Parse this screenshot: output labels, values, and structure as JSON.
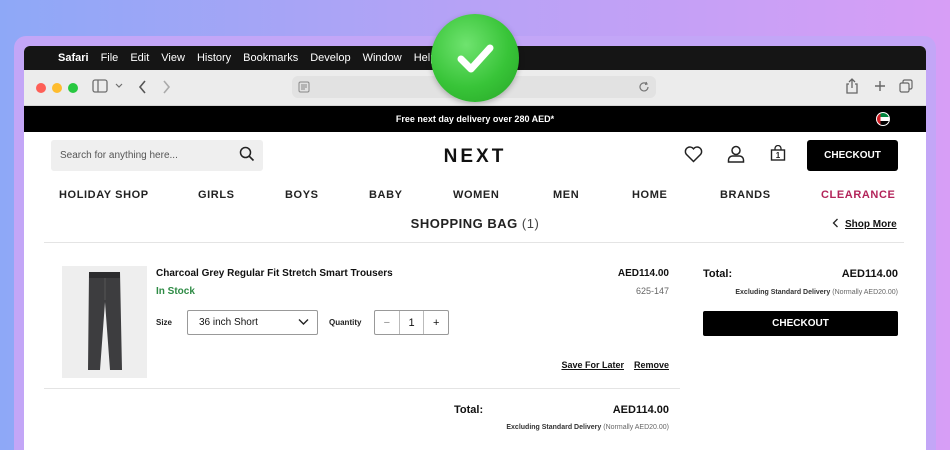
{
  "menubar": {
    "apple": "",
    "items": [
      "Safari",
      "File",
      "Edit",
      "View",
      "History",
      "Bookmarks",
      "Develop",
      "Window",
      "Help"
    ]
  },
  "browser": {
    "traffic_lights": [
      "#fe5f57",
      "#febc2e",
      "#28c840"
    ],
    "icons": [
      "sidebar-icon",
      "chevron-down-icon",
      "back-icon",
      "forward-icon",
      "reader-icon",
      "reload-icon",
      "share-icon",
      "new-tab-icon",
      "tabs-icon"
    ]
  },
  "promo": {
    "text": "Free next day delivery over 280 AED*"
  },
  "header": {
    "search_placeholder": "Search for anything here...",
    "logo": "NEXT",
    "checkout": "CHECKOUT",
    "cart_count": "1"
  },
  "nav": {
    "items": [
      "HOLIDAY SHOP",
      "GIRLS",
      "BOYS",
      "BABY",
      "WOMEN",
      "MEN",
      "HOME",
      "BRANDS",
      "CLEARANCE"
    ],
    "clearance_color": "#b3245a"
  },
  "bag": {
    "title": "SHOPPING BAG",
    "count": "(1)",
    "shop_more": "Shop More"
  },
  "item": {
    "name": "Charcoal Grey Regular Fit Stretch Smart Trousers",
    "stock": "In Stock",
    "price": "AED114.00",
    "sku": "625-147",
    "size_label": "Size",
    "size_value": "36 inch Short",
    "qty_label": "Quantity",
    "qty_minus": "−",
    "qty_value": "1",
    "qty_plus": "+",
    "save_later": "Save For Later",
    "remove": "Remove"
  },
  "summary": {
    "total_label": "Total:",
    "total_value": "AED114.00",
    "excluding": "Excluding Standard Delivery",
    "normally": "(Normally AED20.00)",
    "checkout": "CHECKOUT"
  },
  "colors": {
    "accent_green": "#2e8b45",
    "badge_green": "#38c438"
  }
}
